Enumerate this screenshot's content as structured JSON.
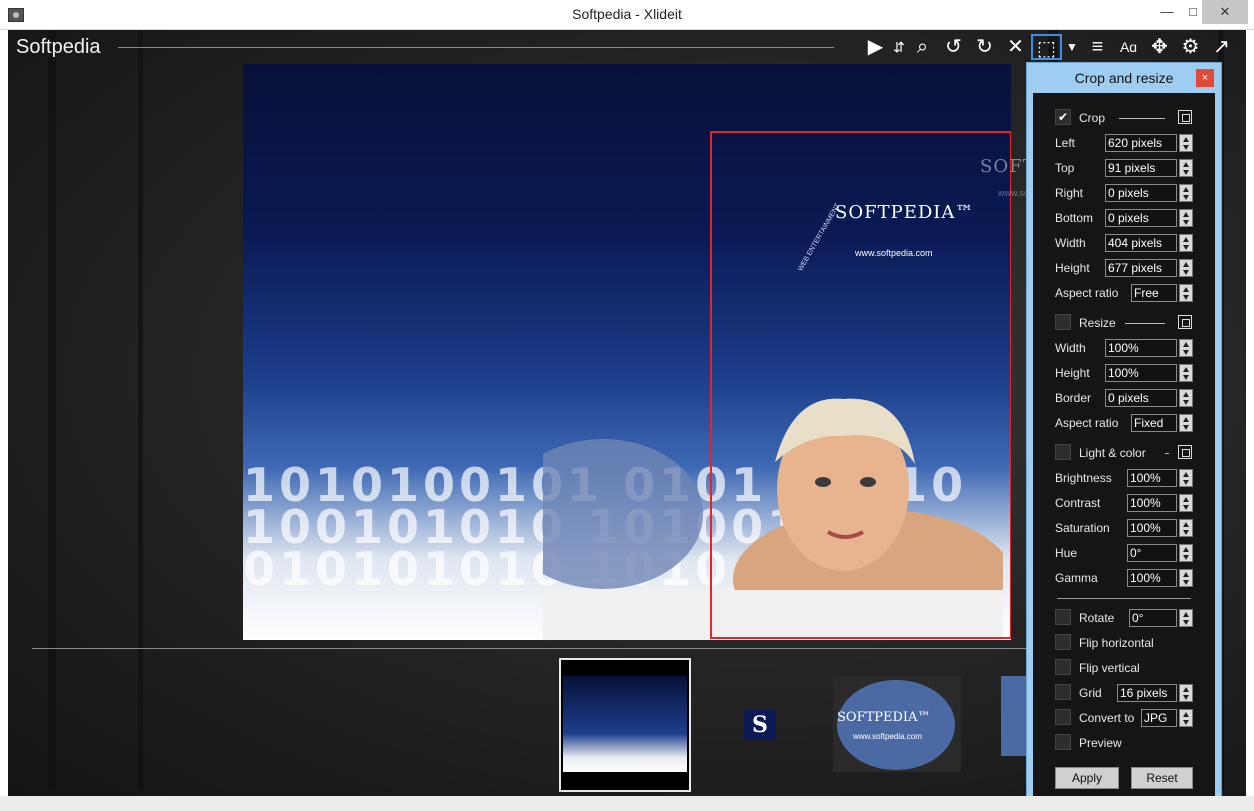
{
  "window": {
    "title": "Softpedia - Xlideit",
    "min": "—",
    "max": "□",
    "close": "✕"
  },
  "header": {
    "brand": "Softpedia"
  },
  "toolbar": {
    "icons": [
      "play-icon",
      "up-down-arrows-icon",
      "zoom-icon",
      "rotate-left-icon",
      "rotate-right-icon",
      "close-x-icon",
      "crop-icon",
      "dropdown-icon",
      "document-list-icon",
      "font-size-icon",
      "fit-icon",
      "gear-icon",
      "fullscreen-icon"
    ],
    "glyphs": [
      "▶",
      "⇵",
      "⌕",
      "↺",
      "↻",
      "✕",
      "⬚",
      "▼",
      "≡",
      "Aɑ",
      "✥",
      "⚙",
      "↗"
    ]
  },
  "image": {
    "logo": "SOFTPEDIA™",
    "url": "www.softpedia.com",
    "arc": "WEB ENTERTAINMENT",
    "digits": "1010100101 0101 01010 100101010 1010010 010101010 1010"
  },
  "watermark": {
    "text": "SOFTPEDIA",
    "sub": "www.softpedia.com"
  },
  "thumbnails": {
    "s_label": "S",
    "c_logo": "SOFTPEDIA™",
    "c_url": "www.softpedia.com"
  },
  "panel": {
    "title": "Crop and resize",
    "close": "×",
    "crop": {
      "label": "Crop",
      "checked": "✔",
      "left_label": "Left",
      "left_value": "620 pixels",
      "top_label": "Top",
      "top_value": "91 pixels",
      "right_label": "Right",
      "right_value": "0 pixels",
      "bottom_label": "Bottom",
      "bottom_value": "0 pixels",
      "width_label": "Width",
      "width_value": "404 pixels",
      "height_label": "Height",
      "height_value": "677 pixels",
      "aspect_label": "Aspect ratio",
      "aspect_value": "Free"
    },
    "resize": {
      "label": "Resize",
      "width_label": "Width",
      "width_value": "100%",
      "height_label": "Height",
      "height_value": "100%",
      "border_label": "Border",
      "border_value": "0 pixels",
      "aspect_label": "Aspect ratio",
      "aspect_value": "Fixed"
    },
    "light": {
      "label": "Light & color",
      "brightness_label": "Brightness",
      "brightness_value": "100%",
      "contrast_label": "Contrast",
      "contrast_value": "100%",
      "saturation_label": "Saturation",
      "saturation_value": "100%",
      "hue_label": "Hue",
      "hue_value": "0°",
      "gamma_label": "Gamma",
      "gamma_value": "100%"
    },
    "options": {
      "rotate_label": "Rotate",
      "rotate_value": "0°",
      "fliph_label": "Flip horizontal",
      "flipv_label": "Flip vertical",
      "grid_label": "Grid",
      "grid_value": "16 pixels",
      "convert_label": "Convert to",
      "convert_value": "JPG",
      "preview_label": "Preview"
    },
    "apply_label": "Apply",
    "reset_label": "Reset"
  }
}
